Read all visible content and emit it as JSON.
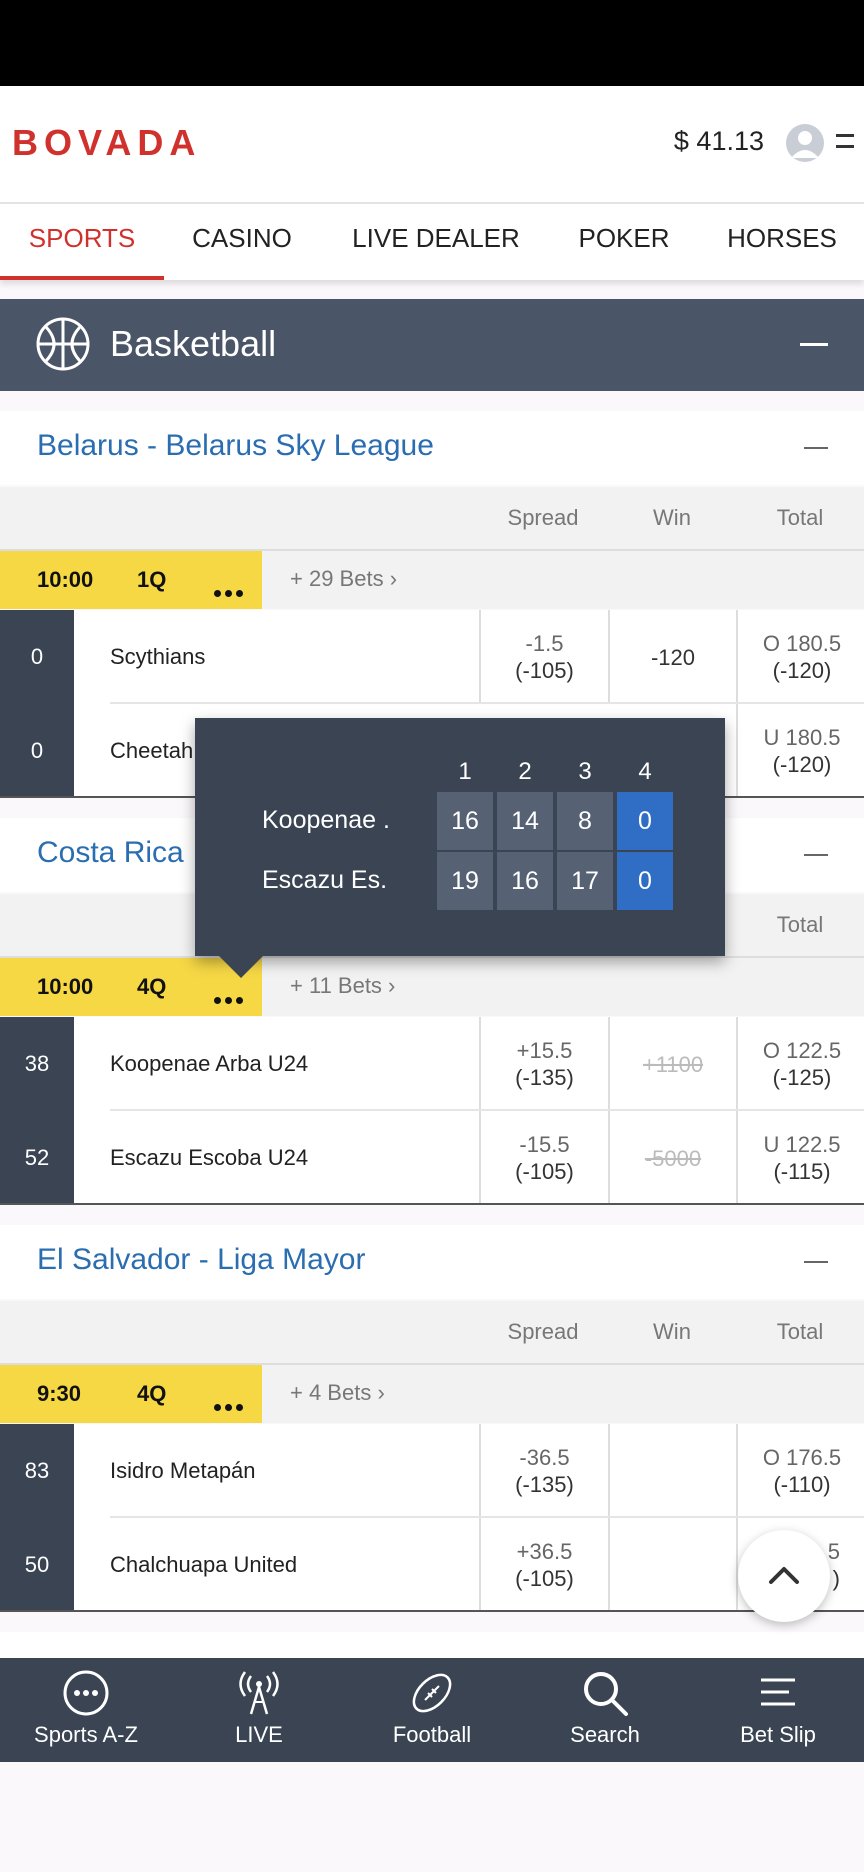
{
  "header": {
    "logo": "BOVADA",
    "balance": "$ 41.13"
  },
  "nav": [
    "SPORTS",
    "CASINO",
    "LIVE DEALER",
    "POKER",
    "HORSES"
  ],
  "sport": {
    "title": "Basketball"
  },
  "columns": {
    "spread": "Spread",
    "win": "Win",
    "total": "Total"
  },
  "leagues": [
    {
      "title": "Belarus - Belarus Sky League",
      "game": {
        "clock": "10:00",
        "quarter": "1Q",
        "bets": "+ 29 Bets"
      },
      "teams": [
        {
          "score": "0",
          "name": "Scythians",
          "spread": "-1.5",
          "spread_odds": "(-105)",
          "win": "-120",
          "total": "O 180.5",
          "total_odds": "(-120)"
        },
        {
          "score": "0",
          "name": "Cheetah",
          "total": "U 180.5",
          "total_odds": "(-120)"
        }
      ]
    },
    {
      "title": "Costa Rica",
      "game": {
        "clock": "10:00",
        "quarter": "4Q",
        "bets": "+ 11 Bets"
      },
      "teams": [
        {
          "score": "38",
          "name": "Koopenae Arba U24",
          "spread": "+15.5",
          "spread_odds": "(-135)",
          "win": "+1100",
          "total": "O 122.5",
          "total_odds": "(-125)"
        },
        {
          "score": "52",
          "name": "Escazu Escoba U24",
          "spread": "-15.5",
          "spread_odds": "(-105)",
          "win": "-5000",
          "total": "U 122.5",
          "total_odds": "(-115)"
        }
      ]
    },
    {
      "title": "El Salvador - Liga Mayor",
      "game": {
        "clock": "9:30",
        "quarter": "4Q",
        "bets": "+ 4 Bets"
      },
      "teams": [
        {
          "score": "83",
          "name": "Isidro Metapán",
          "spread": "-36.5",
          "spread_odds": "(-135)",
          "win": "",
          "total": "O 176.5",
          "total_odds": "(-110)"
        },
        {
          "score": "50",
          "name": "Chalchuapa United",
          "spread": "+36.5",
          "spread_odds": "(-105)",
          "win": "",
          "total": "5",
          "total_odds": ")"
        }
      ]
    }
  ],
  "popup": {
    "quarters": [
      "1",
      "2",
      "3",
      "4"
    ],
    "rows": [
      {
        "team": "Koopenae .",
        "scores": [
          "16",
          "14",
          "8",
          "0"
        ]
      },
      {
        "team": "Escazu Es.",
        "scores": [
          "19",
          "16",
          "17",
          "0"
        ]
      }
    ]
  },
  "bottom_nav": [
    "Sports A-Z",
    "LIVE",
    "Football",
    "Search",
    "Bet Slip"
  ],
  "colors": {
    "brand": "#d0312d",
    "link": "#2a6db0",
    "dark": "#3a4452",
    "highlight": "#f6d845",
    "current_quarter": "#2f6ec4"
  }
}
